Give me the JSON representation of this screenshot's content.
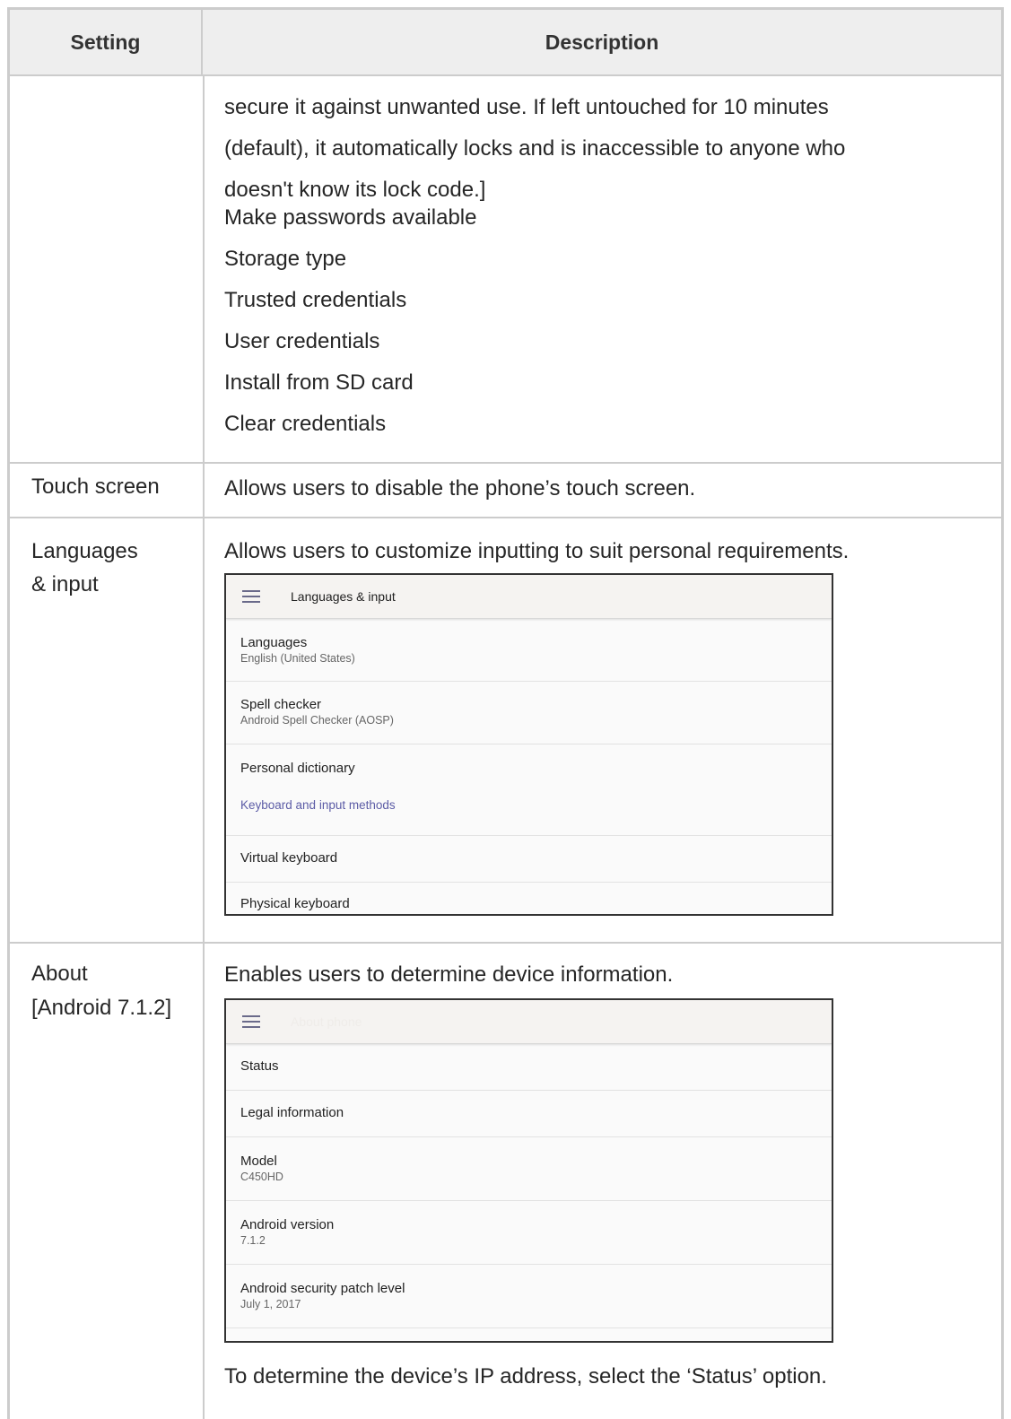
{
  "table": {
    "header": {
      "setting": "Setting",
      "description": "Description"
    },
    "security_continued": {
      "lines": [
        "secure it against unwanted use. If left untouched for 10 minutes",
        "(default), it automatically locks and is inaccessible to anyone who",
        "doesn't know its lock code.]",
        "Make passwords available",
        "Storage type",
        "Trusted credentials",
        "User credentials",
        "Install from SD card",
        "Clear credentials"
      ]
    },
    "touch_screen": {
      "setting": "Touch screen",
      "description": "Allows users to disable the phone’s touch screen."
    },
    "languages": {
      "setting_line1": "Languages",
      "setting_line2": "& input",
      "description": "Allows users to customize inputting to suit personal requirements.",
      "screenshot": {
        "title": "Languages & input",
        "items": [
          {
            "label": "Languages",
            "sub": "English (United States)"
          },
          {
            "label": "Spell checker",
            "sub": "Android Spell Checker (AOSP)"
          },
          {
            "label": "Personal dictionary",
            "sub": ""
          },
          {
            "label": "Keyboard and input methods",
            "sub": "",
            "section": true
          },
          {
            "label": "Virtual keyboard",
            "sub": ""
          },
          {
            "label": "Physical keyboard",
            "sub": ""
          }
        ]
      }
    },
    "about": {
      "setting_line1": "About",
      "setting_line2": "[Android 7.1.2]",
      "description": "Enables users to determine device information.",
      "screenshot": {
        "title": "About phone",
        "items": [
          {
            "label": "Status",
            "sub": ""
          },
          {
            "label": "Legal information",
            "sub": ""
          },
          {
            "label": "Model",
            "sub": "C450HD"
          },
          {
            "label": "Android version",
            "sub": "7.1.2"
          },
          {
            "label": "Android security patch level",
            "sub": "July 1, 2017"
          }
        ]
      },
      "footer": "To determine the device’s IP address, select the ‘Status’ option."
    }
  }
}
